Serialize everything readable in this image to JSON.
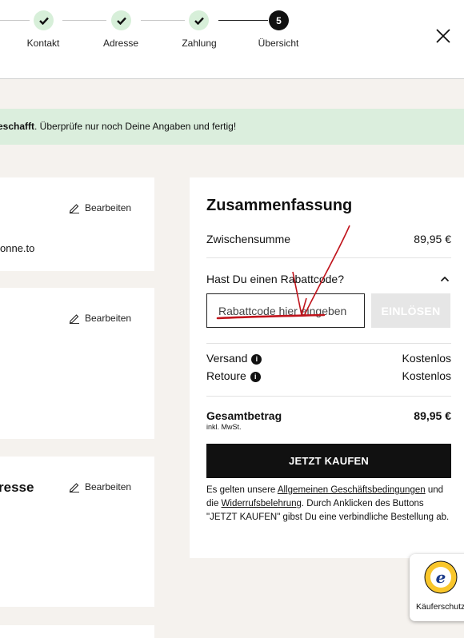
{
  "stepper": {
    "steps": [
      {
        "label": "Kontakt",
        "state": "done",
        "icon": "check-icon"
      },
      {
        "label": "Adresse",
        "state": "done",
        "icon": "check-icon"
      },
      {
        "label": "Zahlung",
        "state": "done",
        "icon": "check-icon"
      },
      {
        "label": "Übersicht",
        "state": "active",
        "number": "5"
      }
    ],
    "close_icon": "close-icon"
  },
  "banner": {
    "bold": "eschafft",
    "text": ". Überprüfe nur noch Deine Angaben und fertig!",
    "color": "#dbeedd"
  },
  "cards": {
    "contact": {
      "edit_label": "Bearbeiten",
      "email_fragment": "onne.to"
    },
    "address": {
      "edit_label": "Bearbeiten"
    },
    "billing": {
      "title_fragment": "resse",
      "edit_label": "Bearbeiten"
    }
  },
  "summary": {
    "title": "Zusammenfassung",
    "subtotal_label": "Zwischensumme",
    "subtotal_value": "89,95 €",
    "coupon_question": "Hast Du einen Rabattcode?",
    "coupon_placeholder": "Rabattcode hier eingeben",
    "redeem_label": "EINLÖSEN",
    "shipping_label": "Versand",
    "shipping_value": "Kostenlos",
    "returns_label": "Retoure",
    "returns_value": "Kostenlos",
    "total_label": "Gesamtbetrag",
    "total_sub": "inkl. MwSt.",
    "total_value": "89,95 €",
    "buy_label": "JETZT KAUFEN",
    "legal": {
      "pre": "Es gelten unsere ",
      "link1": "Allgemeinen Geschäftsbedingungen",
      "mid": " und die ",
      "link2": "Widerrufsbelehrung",
      "post": ". Durch Anklicken des Buttons \"JETZT KAUFEN\" gibst Du eine verbindliche Bestellung ab."
    }
  },
  "trust_badge": {
    "label": "Käuferschutz",
    "icon": "trusted-shops-icon"
  },
  "colors": {
    "accent_dark": "#111111",
    "annotation_red": "#c0141c",
    "step_done": "#d7efd9",
    "page_bg": "#f5f2ee"
  }
}
